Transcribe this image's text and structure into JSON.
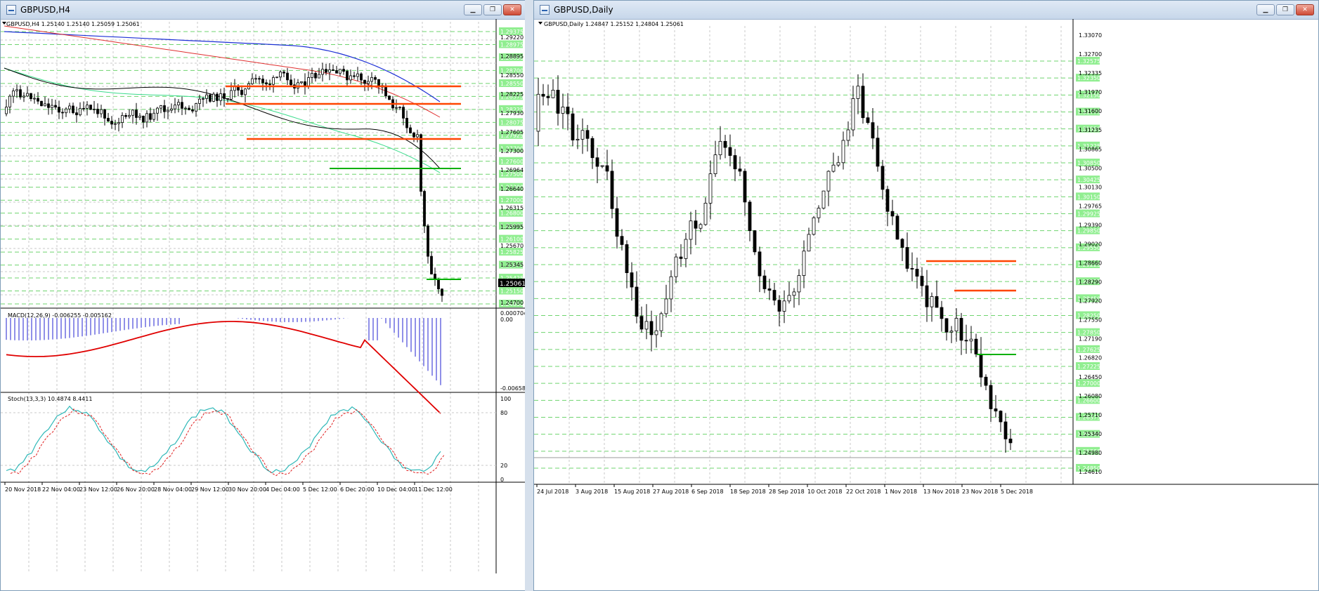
{
  "left": {
    "title": "GBPUSD,H4",
    "info": "GBPUSD,H4  1.25140 1.25140 1.25059 1.25061",
    "price_axis": [
      "1.29220",
      "1.28895",
      "1.28550",
      "1.28225",
      "1.27930",
      "1.27605",
      "1.27300",
      "1.26964",
      "1.26640",
      "1.26315",
      "1.25995",
      "1.25670",
      "1.25345",
      "1.25061",
      "1.24700"
    ],
    "current_price": "1.25061",
    "green_labels": [
      "1.29375",
      "1.28975",
      "1.28850",
      "1.28700",
      "1.28550",
      "1.28375",
      "1.28225",
      "1.28075",
      "1.27925",
      "1.27700",
      "1.27600",
      "1.27500",
      "1.27300",
      "1.27000",
      "1.26800",
      "1.26500",
      "1.26100",
      "1.25825",
      "1.25675",
      "1.25425",
      "1.25150",
      "1.24850"
    ],
    "macd_label": "MACD(12,26,9) -0.006255 -0.005162",
    "macd_axis": [
      "0.000704",
      "0.00",
      "-0.006586"
    ],
    "stoch_label": "Stoch(13,3,3) 10.4874 8.4411",
    "stoch_axis": [
      "100",
      "80",
      "20",
      "0"
    ],
    "time_axis": [
      "20 Nov 2018",
      "22 Nov 04:00",
      "23 Nov 12:00",
      "26 Nov 20:00",
      "28 Nov 04:00",
      "29 Nov 12:00",
      "30 Nov 20:00",
      "4 Dec 04:00",
      "5 Dec 12:00",
      "6 Dec 20:00",
      "10 Dec 04:00",
      "11 Dec 12:00"
    ]
  },
  "right": {
    "title": "GBPUSD,Daily",
    "info": "GBPUSD,Daily  1.24847 1.25152 1.24804 1.25061",
    "price_axis": [
      "1.33070",
      "1.32700",
      "1.32335",
      "1.31970",
      "1.31600",
      "1.31235",
      "1.30865",
      "1.30500",
      "1.30130",
      "1.29765",
      "1.29390",
      "1.29020",
      "1.28660",
      "1.28290",
      "1.27920",
      "1.27550",
      "1.27190",
      "1.26820",
      "1.26450",
      "1.26080",
      "1.25710",
      "1.25340",
      "1.24980",
      "1.24610"
    ],
    "green_labels": [
      "1.32575",
      "1.32350",
      "1.32150",
      "1.31775",
      "1.31550",
      "1.31225",
      "1.30850",
      "1.30425",
      "1.30150",
      "1.29925",
      "1.29850",
      "1.29550",
      "1.29225",
      "1.28775",
      "1.28450",
      "1.28250",
      "1.27850",
      "1.27625",
      "1.27225",
      "1.27000",
      "1.26600",
      "1.26375",
      "1.25650",
      "1.25200",
      "1.24850"
    ],
    "time_axis": [
      "24 Jul 2018",
      "3 Aug 2018",
      "15 Aug 2018",
      "27 Aug 2018",
      "6 Sep 2018",
      "18 Sep 2018",
      "28 Sep 2018",
      "10 Oct 2018",
      "22 Oct 2018",
      "1 Nov 2018",
      "13 Nov 2018",
      "23 Nov 2018",
      "5 Dec 2018"
    ]
  },
  "colors": {
    "green_label_bg": "#90ee90",
    "green_line": "#00b000",
    "resistance": "#ff4500",
    "ma_blue": "#1c2fd6",
    "ma_red": "#e03030",
    "ma_green": "#3bdc8c",
    "macd_signal": "#e00000",
    "macd_hist": "#2020d0",
    "stoch_main": "#2fb8b8",
    "stoch_signal": "#e02020"
  }
}
